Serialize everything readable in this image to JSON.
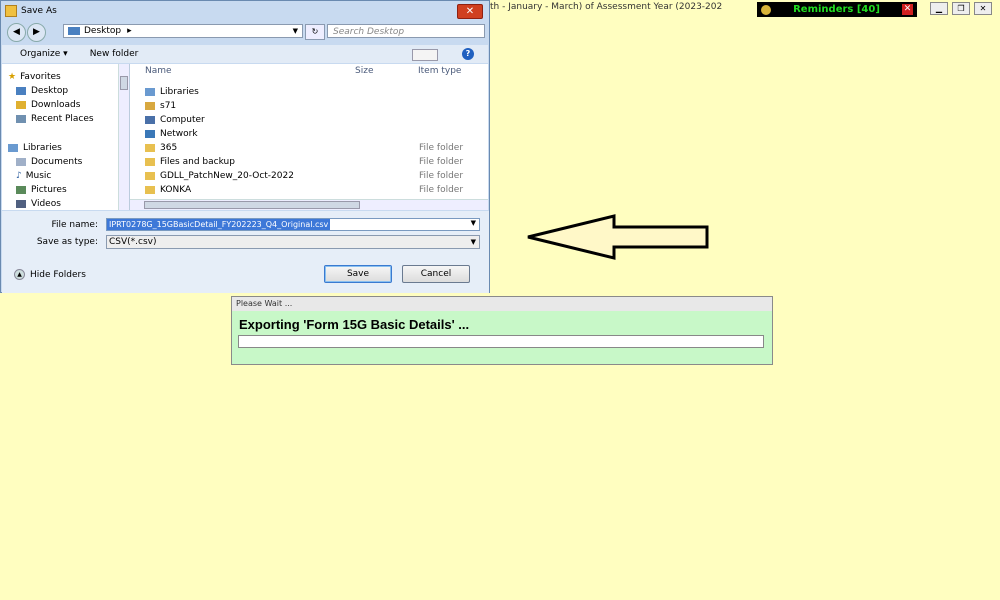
{
  "app": {
    "title_fragment": "th - January - March) of Assessment Year (2023-202",
    "reminders": "Reminders [40]"
  },
  "save_dialog": {
    "title": "Save As",
    "address": "Desktop",
    "search_placeholder": "Search Desktop",
    "toolbar": {
      "organize": "Organize ▾",
      "new_folder": "New folder"
    },
    "nav": {
      "favorites": "Favorites",
      "favorites_items": [
        "Desktop",
        "Downloads",
        "Recent Places"
      ],
      "libraries": "Libraries",
      "libraries_items": [
        "Documents",
        "Music",
        "Pictures",
        "Videos"
      ]
    },
    "columns": {
      "name": "Name",
      "size": "Size",
      "type": "Item type"
    },
    "files": [
      {
        "name": "Libraries",
        "type": ""
      },
      {
        "name": "s71",
        "type": ""
      },
      {
        "name": "Computer",
        "type": ""
      },
      {
        "name": "Network",
        "type": ""
      },
      {
        "name": "365",
        "type": "File folder"
      },
      {
        "name": "Files and backup",
        "type": "File folder"
      },
      {
        "name": "GDLL_PatchNew_20-Oct-2022",
        "type": "File folder"
      },
      {
        "name": "KONKA",
        "type": "File folder"
      }
    ],
    "file_name_label": "File name:",
    "file_name_value": "IPRT0278G_15GBasicDetail_FY202223_Q4_Original.csv",
    "save_type_label": "Save as type:",
    "save_type_value": "CSV(*.csv)",
    "hide_folders": "Hide Folders",
    "save": "Save",
    "cancel": "Cancel"
  },
  "wait_box": {
    "title": "Please Wait ...",
    "message": "Exporting 'Form 15G Basic Details' ...",
    "progress": 0
  },
  "colors": {
    "background": "#fffec0",
    "wait_bg": "#c8f8c8",
    "selection": "#3d78d8",
    "reminder_text": "#22dd22"
  }
}
